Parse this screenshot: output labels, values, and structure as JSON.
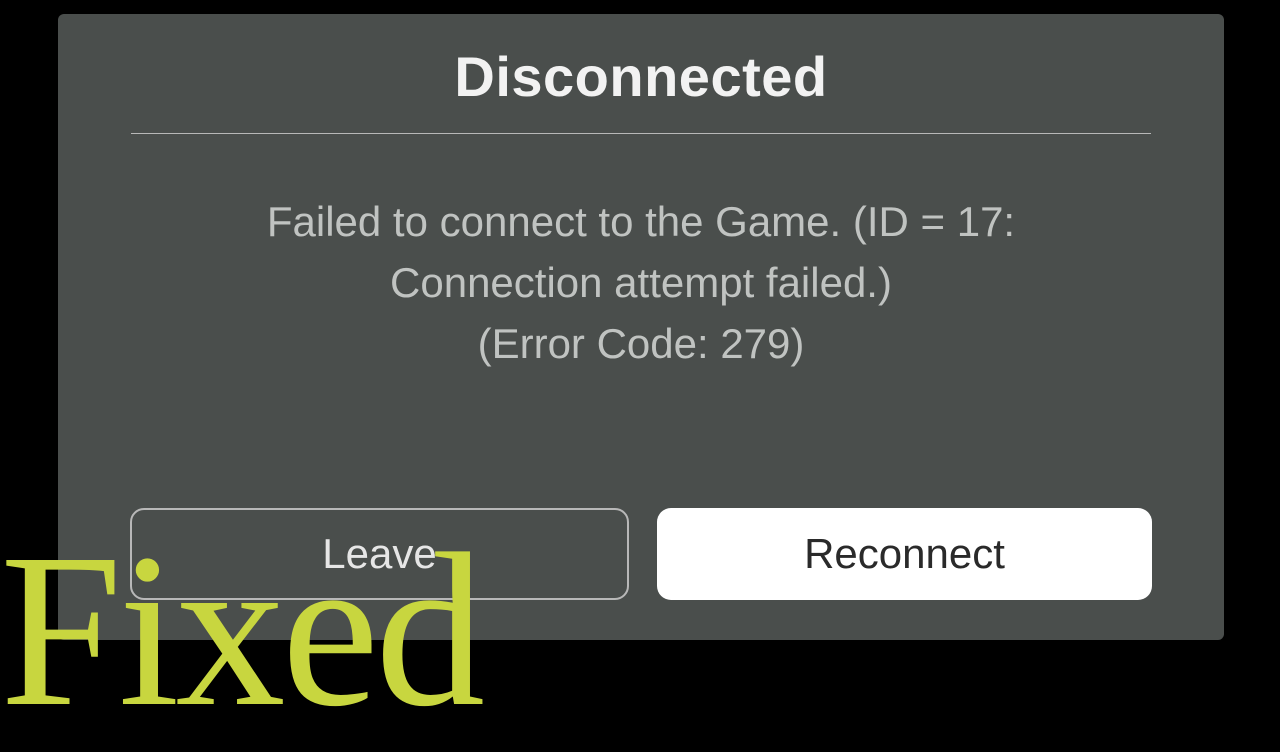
{
  "dialog": {
    "title": "Disconnected",
    "message": "Failed to connect to the Game. (ID = 17:\nConnection attempt failed.)\n(Error Code: 279)",
    "leave_label": "Leave",
    "reconnect_label": "Reconnect"
  },
  "overlay": {
    "text": "Fixed"
  }
}
